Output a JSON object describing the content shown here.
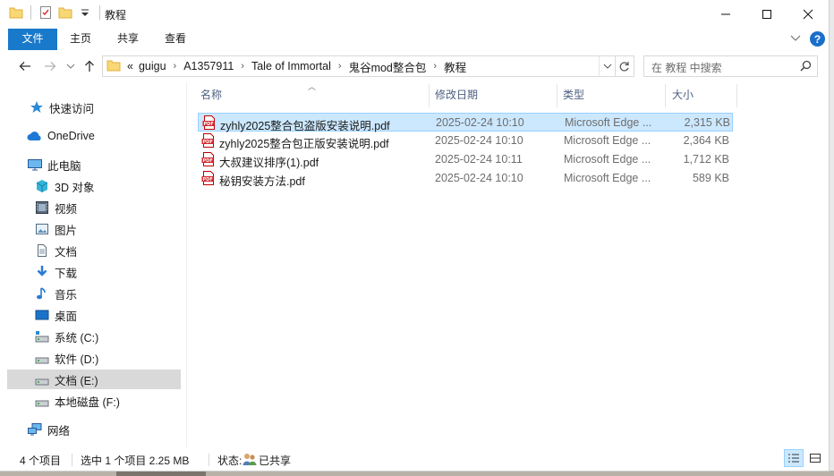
{
  "window": {
    "title": "教程"
  },
  "ribbon": {
    "tabs": [
      {
        "label": "文件"
      },
      {
        "label": "主页"
      },
      {
        "label": "共享"
      },
      {
        "label": "查看"
      }
    ]
  },
  "address": {
    "overflow": "«",
    "crumbs": [
      "guigu",
      "A1357911",
      "Tale of Immortal",
      "鬼谷mod整合包",
      "教程"
    ]
  },
  "search": {
    "placeholder": "在 教程 中搜索"
  },
  "sidebar": {
    "items": [
      {
        "label": "快速访问",
        "icon": "star-icon"
      },
      {
        "label": "OneDrive",
        "icon": "cloud-icon"
      },
      {
        "label": "此电脑",
        "icon": "computer-icon"
      },
      {
        "label": "3D 对象",
        "icon": "3d-objects-icon"
      },
      {
        "label": "视频",
        "icon": "video-icon"
      },
      {
        "label": "图片",
        "icon": "pictures-icon"
      },
      {
        "label": "文档",
        "icon": "documents-icon"
      },
      {
        "label": "下载",
        "icon": "download-icon"
      },
      {
        "label": "音乐",
        "icon": "music-icon"
      },
      {
        "label": "桌面",
        "icon": "desktop-icon"
      },
      {
        "label": "系统 (C:)",
        "icon": "system-drive-icon"
      },
      {
        "label": "软件 (D:)",
        "icon": "drive-icon"
      },
      {
        "label": "文档 (E:)",
        "icon": "drive-icon",
        "selected": true
      },
      {
        "label": "本地磁盘 (F:)",
        "icon": "drive-icon"
      },
      {
        "label": "网络",
        "icon": "network-icon"
      }
    ]
  },
  "file_list": {
    "columns": [
      "名称",
      "修改日期",
      "类型",
      "大小"
    ],
    "rows": [
      {
        "name": "zyhly2025整合包盗版安装说明.pdf",
        "date": "2025-02-24 10:10",
        "type": "Microsoft Edge ...",
        "size": "2,315 KB",
        "selected": true
      },
      {
        "name": "zyhly2025整合包正版安装说明.pdf",
        "date": "2025-02-24 10:10",
        "type": "Microsoft Edge ...",
        "size": "2,364 KB"
      },
      {
        "name": "大叔建议排序(1).pdf",
        "date": "2025-02-24 10:11",
        "type": "Microsoft Edge ...",
        "size": "1,712 KB"
      },
      {
        "name": "秘钥安装方法.pdf",
        "date": "2025-02-24 10:10",
        "type": "Microsoft Edge ...",
        "size": "589 KB"
      }
    ]
  },
  "status": {
    "count": "4 个项目",
    "selection": "选中 1 个项目  2.25 MB",
    "state": "状态:",
    "shared": "已共享"
  },
  "colors": {
    "accent": "#1979ca",
    "selection_bg": "#cce8ff",
    "selection_border": "#99d1ff",
    "header_text": "#4d6082"
  }
}
